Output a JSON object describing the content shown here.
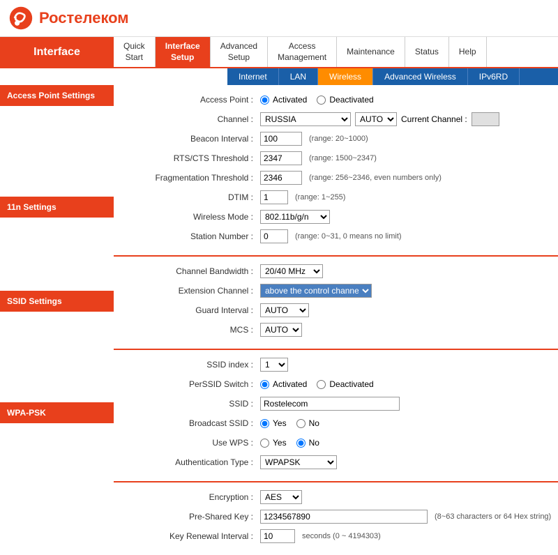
{
  "logo": {
    "text": "Ростелеком"
  },
  "nav": {
    "sidebar_label": "Interface",
    "items": [
      {
        "id": "quick-start",
        "label": "Quick\nStart"
      },
      {
        "id": "interface-setup",
        "label": "Interface\nSetup",
        "active": true
      },
      {
        "id": "advanced-setup",
        "label": "Advanced\nSetup"
      },
      {
        "id": "access-management",
        "label": "Access\nManagement"
      },
      {
        "id": "maintenance",
        "label": "Maintenance"
      },
      {
        "id": "status",
        "label": "Status"
      },
      {
        "id": "help",
        "label": "Help"
      }
    ]
  },
  "sub_nav": {
    "items": [
      {
        "id": "internet",
        "label": "Internet"
      },
      {
        "id": "lan",
        "label": "LAN"
      },
      {
        "id": "wireless",
        "label": "Wireless",
        "active": true
      },
      {
        "id": "advanced-wireless",
        "label": "Advanced Wireless"
      },
      {
        "id": "ipv6rd",
        "label": "IPv6RD"
      }
    ]
  },
  "sidebar": {
    "sections": [
      {
        "id": "access-point",
        "label": "Access Point Settings"
      },
      {
        "id": "11n-settings",
        "label": "11n Settings"
      },
      {
        "id": "ssid-settings",
        "label": "SSID Settings"
      },
      {
        "id": "wpa-psk",
        "label": "WPA-PSK"
      }
    ]
  },
  "access_point": {
    "section_label": "Access Point Settings",
    "access_point_label": "Access Point :",
    "activated_label": "Activated",
    "deactivated_label": "Deactivated",
    "channel_label": "Channel :",
    "channel_value": "RUSSIA",
    "channel_auto": "AUTO",
    "current_channel_label": "Current Channel :",
    "beacon_label": "Beacon Interval :",
    "beacon_value": "100",
    "beacon_hint": "(range: 20~1000)",
    "rts_label": "RTS/CTS Threshold :",
    "rts_value": "2347",
    "rts_hint": "(range: 1500~2347)",
    "frag_label": "Fragmentation Threshold :",
    "frag_value": "2346",
    "frag_hint": "(range: 256~2346, even numbers only)",
    "dtim_label": "DTIM :",
    "dtim_value": "1",
    "dtim_hint": "(range: 1~255)",
    "wireless_mode_label": "Wireless Mode :",
    "wireless_mode_value": "802.11b/g/n",
    "station_number_label": "Station Number :",
    "station_number_value": "0",
    "station_number_hint": "(range: 0~31, 0 means no limit)"
  },
  "settings_11n": {
    "section_label": "11n Settings",
    "channel_bw_label": "Channel Bandwidth :",
    "channel_bw_value": "20/40 MHz",
    "ext_channel_label": "Extension Channel :",
    "ext_channel_value": "above the control channel",
    "guard_interval_label": "Guard Interval :",
    "guard_interval_value": "AUTO",
    "mcs_label": "MCS :",
    "mcs_value": "AUTO"
  },
  "ssid": {
    "section_label": "SSID Settings",
    "ssid_index_label": "SSID index :",
    "ssid_index_value": "1",
    "perssid_switch_label": "PerSSID Switch :",
    "activated_label": "Activated",
    "deactivated_label": "Deactivated",
    "ssid_label": "SSID :",
    "ssid_value": "Rostelecom",
    "broadcast_ssid_label": "Broadcast SSID :",
    "yes_label": "Yes",
    "no_label": "No",
    "use_wps_label": "Use WPS :",
    "yes_label2": "Yes",
    "no_label2": "No",
    "auth_type_label": "Authentication Type :",
    "auth_type_value": "WPAPSK"
  },
  "wpa_psk": {
    "section_label": "WPA-PSK",
    "encryption_label": "Encryption :",
    "encryption_value": "AES",
    "psk_label": "Pre-Shared Key :",
    "psk_value": "1234567890",
    "psk_hint": "(8~63 characters or 64 Hex string)",
    "key_renewal_label": "Key Renewal Interval :",
    "key_renewal_value": "10",
    "key_renewal_hint": "seconds (0 ~ 4194303)"
  },
  "colors": {
    "orange": "#e8401c",
    "blue": "#1a5fa8",
    "active_tab": "#ff8c00"
  }
}
